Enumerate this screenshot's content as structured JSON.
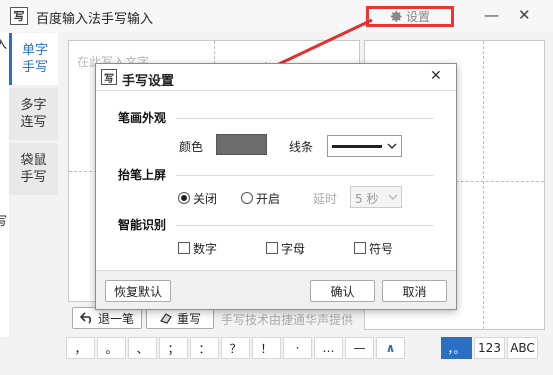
{
  "window": {
    "app_icon": "写",
    "title": "百度输入法手写输入",
    "settings_label": "设置",
    "minimize_glyph": "—",
    "close_glyph": "✕"
  },
  "left_edge": {
    "chars": [
      "入",
      "写",
      "插"
    ]
  },
  "tabs": [
    {
      "label": "单字手写",
      "line1": "单字",
      "line2": "手写",
      "selected": true
    },
    {
      "label": "多字连写",
      "line1": "多字",
      "line2": "连写",
      "selected": false
    },
    {
      "label": "袋鼠手写",
      "line1": "袋鼠",
      "line2": "手写",
      "selected": false
    }
  ],
  "canvas": {
    "placeholder": "在此写入文字"
  },
  "actions": {
    "undo_label": "退一笔",
    "rewrite_label": "重写",
    "credit": "手写技术由捷通华声提供"
  },
  "punct_keys": [
    "，",
    "。",
    "、",
    "；",
    "：",
    "？",
    "！",
    "·",
    "…",
    "—"
  ],
  "expand_glyph": "∧",
  "modes": [
    {
      "label": "，。",
      "selected": true
    },
    {
      "label": "123",
      "selected": false
    },
    {
      "label": "ABC",
      "selected": false
    }
  ],
  "dialog": {
    "icon": "写",
    "title": "手写设置",
    "close_glyph": "✕",
    "stroke_section": "笔画外观",
    "color_label": "颜色",
    "color_value": "#6d6d6d",
    "line_label": "线条",
    "lift_section": "抬笔上屏",
    "off_label": "关闭",
    "on_label": "开启",
    "lift_on": false,
    "delay_label": "延时",
    "delay_value": "5 秒",
    "smart_section": "智能识别",
    "digits_label": "数字",
    "letters_label": "字母",
    "symbols_label": "符号",
    "restore_label": "恢复默认",
    "ok_label": "确认",
    "cancel_label": "取消"
  },
  "colors": {
    "accent": "#2a6fc4",
    "highlight": "#e33333",
    "arrow": "#e03030"
  }
}
